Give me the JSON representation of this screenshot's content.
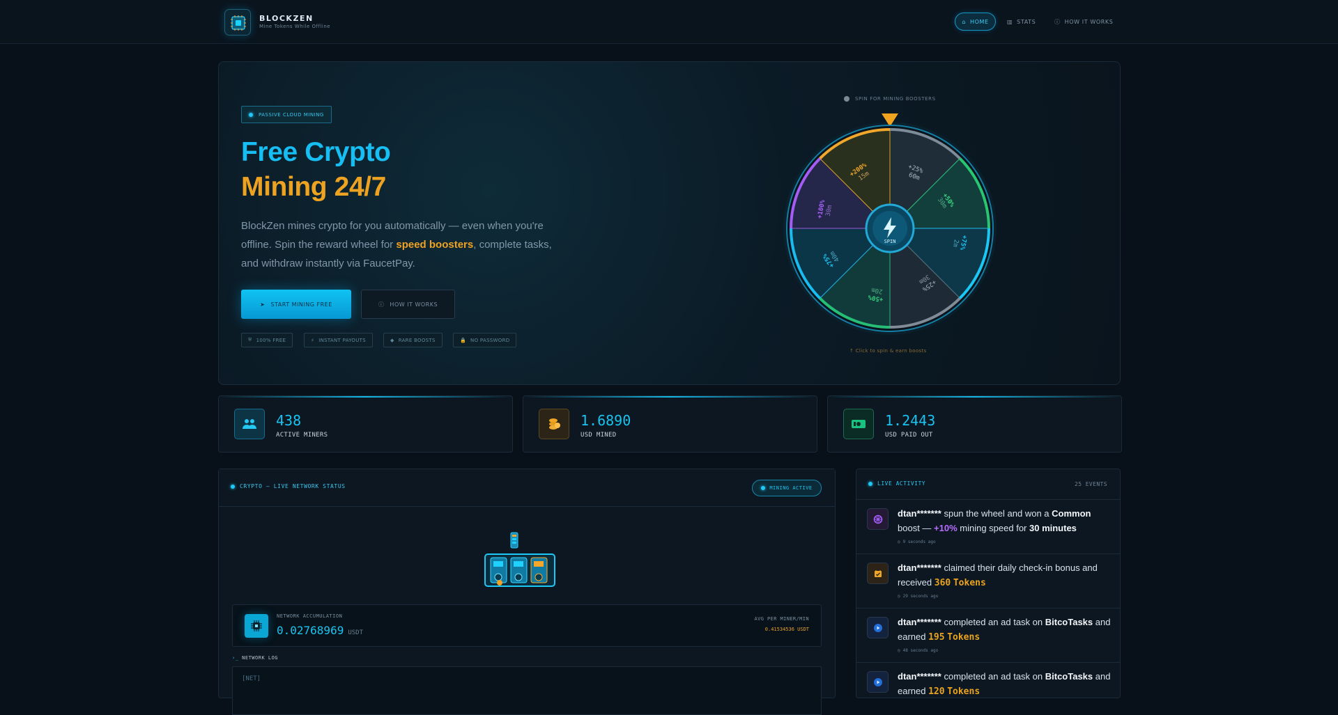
{
  "brand": {
    "name": "BLOCKZEN",
    "tagline": "Mine Tokens While Offline"
  },
  "nav": [
    {
      "label": "HOME"
    },
    {
      "label": "STATS"
    },
    {
      "label": "HOW IT WORKS"
    }
  ],
  "hero": {
    "badge": "PASSIVE CLOUD MINING",
    "title_line1": "Free Crypto",
    "title_line2": "Mining 24/7",
    "description_before": "BlockZen mines crypto for you automatically — even when you're offline. Spin the reward wheel for ",
    "description_highlight": "speed boosters",
    "description_after": ", complete tasks, and withdraw instantly via FaucetPay.",
    "primary_button": "START MINING FREE",
    "secondary_button": "HOW IT WORKS",
    "pills": [
      "100% FREE",
      "INSTANT PAYOUTS",
      "RARE BOOSTS",
      "NO PASSWORD"
    ]
  },
  "wheel": {
    "label": "SPIN FOR MINING BOOSTERS",
    "center": "SPIN",
    "help": "↑ Click to spin & earn boosts",
    "segments": [
      {
        "boost": "+25%",
        "time": "60m"
      },
      {
        "boost": "+50%",
        "time": "30m"
      },
      {
        "boost": "+75%",
        "time": "2m"
      },
      {
        "boost": "+25%",
        "time": "30m"
      },
      {
        "boost": "+50%",
        "time": "20m"
      },
      {
        "boost": "+75%",
        "time": "40m"
      },
      {
        "boost": "+100%",
        "time": "30m"
      },
      {
        "boost": "+200%",
        "time": "15m"
      }
    ]
  },
  "stats": [
    {
      "value": "438",
      "label": "ACTIVE MINERS"
    },
    {
      "value": "1.6890",
      "label": "USD MINED"
    },
    {
      "value": "1.2443",
      "label": "USD PAID OUT"
    }
  ],
  "network": {
    "title": "CRYPTO — LIVE NETWORK STATUS",
    "status": "MINING ACTIVE",
    "accumulation_label": "NETWORK ACCUMULATION",
    "accumulation_value": "0.02768969",
    "accumulation_unit": "USDT",
    "avg_label": "AVG PER MINER/MIN",
    "avg_value": "0.41534536 USDT",
    "log_title": "NETWORK LOG",
    "log_line": "[NET]"
  },
  "activity": {
    "title": "LIVE ACTIVITY",
    "count": "25 EVENTS",
    "events": [
      {
        "user": "dtan*******",
        "before": " spun the wheel and won a ",
        "item": "Common",
        "middle": " boost — ",
        "value": "+10%",
        "after": " mining speed for ",
        "duration": "30 minutes",
        "time": "9 seconds ago"
      },
      {
        "user": "dtan*******",
        "before": " claimed their daily check-in bonus and received ",
        "value": "360",
        "unit": "Tokens",
        "time": "29 seconds ago"
      },
      {
        "user": "dtan*******",
        "before": " completed an ad task on ",
        "item": "BitcoTasks",
        "middle": " and earned ",
        "value": "195",
        "unit": "Tokens",
        "time": "48 seconds ago"
      },
      {
        "user": "dtan*******",
        "before": " completed an ad task on ",
        "item": "BitcoTasks",
        "middle": " and earned ",
        "value": "120",
        "unit": "Tokens"
      }
    ]
  },
  "colors": {
    "accent": "#16bef3",
    "gold": "#eda321",
    "background": "#081119"
  }
}
